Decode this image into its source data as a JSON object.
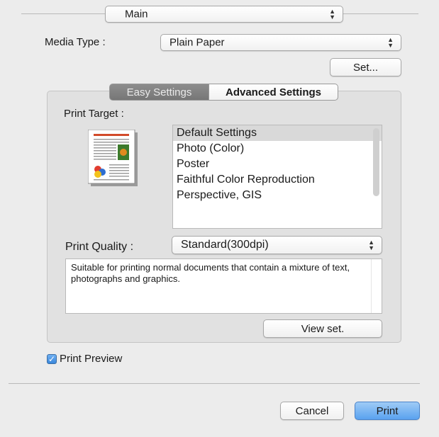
{
  "panel_popup": {
    "value": "Main"
  },
  "media_type": {
    "label": "Media Type :",
    "value": "Plain Paper",
    "set_button": "Set..."
  },
  "tabs": [
    {
      "label": "Easy Settings",
      "selected": true
    },
    {
      "label": "Advanced Settings",
      "selected": false
    }
  ],
  "print_target": {
    "label": "Print Target :",
    "options": [
      "Default Settings",
      "Photo (Color)",
      "Poster",
      "Faithful Color Reproduction",
      "Perspective, GIS"
    ],
    "selected_index": 0
  },
  "print_quality": {
    "label": "Print Quality :",
    "value": "Standard(300dpi)",
    "description": "Suitable for printing normal documents that contain a mixture of text, photographs and graphics.",
    "view_button": "View set."
  },
  "print_preview": {
    "label": "Print Preview",
    "checked": true
  },
  "footer": {
    "cancel": "Cancel",
    "print": "Print"
  },
  "colors": {
    "default_button": "#5aa2ef",
    "selected_tab": "#7f7f7f",
    "background": "#ececec"
  },
  "icons": {
    "popup_arrows": "updown-arrows-icon",
    "check": "checkmark-icon",
    "preview": "page-thumbnail-icon"
  }
}
